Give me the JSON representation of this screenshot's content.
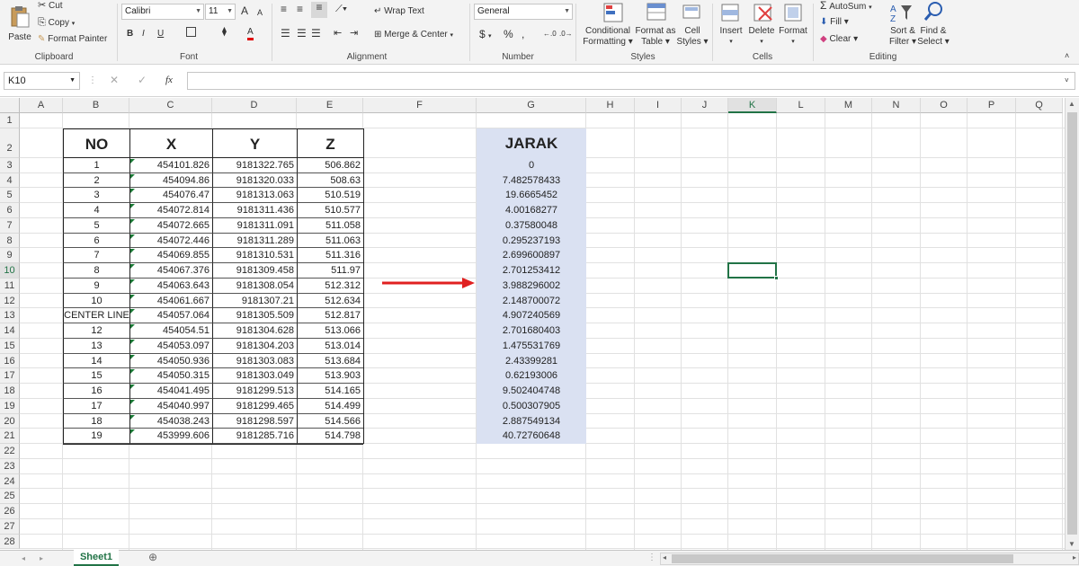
{
  "ribbon": {
    "clipboard": {
      "paste": "Paste",
      "cut": "Cut",
      "copy": "Copy",
      "format_painter": "Format Painter",
      "group": "Clipboard"
    },
    "font": {
      "name": "Calibri",
      "size": "11",
      "bold": "B",
      "italic": "I",
      "underline": "U",
      "grow": "A",
      "shrink": "A",
      "color_a": "A",
      "group": "Font"
    },
    "alignment": {
      "wrap": "Wrap Text",
      "merge": "Merge & Center",
      "group": "Alignment"
    },
    "number": {
      "format": "General",
      "currency": "$",
      "percent": "%",
      "comma": ",",
      "group": "Number"
    },
    "styles": {
      "conditional": "Conditional",
      "conditional2": "Formatting",
      "format_as": "Format as",
      "format_as2": "Table",
      "cell": "Cell",
      "cell2": "Styles",
      "group": "Styles"
    },
    "cells": {
      "insert": "Insert",
      "delete": "Delete",
      "format": "Format",
      "group": "Cells"
    },
    "editing": {
      "autosum": "AutoSum",
      "fill": "Fill",
      "clear": "Clear",
      "sort": "Sort &",
      "sort2": "Filter",
      "find": "Find &",
      "find2": "Select",
      "group": "Editing"
    }
  },
  "formula_bar": {
    "name_box": "K10",
    "fx": "fx",
    "value": ""
  },
  "columns": [
    "A",
    "B",
    "C",
    "D",
    "E",
    "F",
    "G",
    "H",
    "I",
    "J",
    "K",
    "L",
    "M",
    "N",
    "O",
    "P",
    "Q"
  ],
  "selected_column": "K",
  "selected_row": "10",
  "rows": [
    "1",
    "2",
    "3",
    "4",
    "5",
    "6",
    "7",
    "8",
    "9",
    "10",
    "11",
    "12",
    "13",
    "14",
    "15",
    "16",
    "17",
    "18",
    "19",
    "20",
    "21",
    "22",
    "23",
    "24",
    "25",
    "26",
    "27",
    "28"
  ],
  "table": {
    "headers": {
      "no": "NO",
      "x": "X",
      "y": "Y",
      "z": "Z"
    },
    "data": [
      {
        "no": "1",
        "x": "454101.826",
        "y": "9181322.765",
        "z": "506.862"
      },
      {
        "no": "2",
        "x": "454094.86",
        "y": "9181320.033",
        "z": "508.63"
      },
      {
        "no": "3",
        "x": "454076.47",
        "y": "9181313.063",
        "z": "510.519"
      },
      {
        "no": "4",
        "x": "454072.814",
        "y": "9181311.436",
        "z": "510.577"
      },
      {
        "no": "5",
        "x": "454072.665",
        "y": "9181311.091",
        "z": "511.058"
      },
      {
        "no": "6",
        "x": "454072.446",
        "y": "9181311.289",
        "z": "511.063"
      },
      {
        "no": "7",
        "x": "454069.855",
        "y": "9181310.531",
        "z": "511.316"
      },
      {
        "no": "8",
        "x": "454067.376",
        "y": "9181309.458",
        "z": "511.97"
      },
      {
        "no": "9",
        "x": "454063.643",
        "y": "9181308.054",
        "z": "512.312"
      },
      {
        "no": "10",
        "x": "454061.667",
        "y": "9181307.21",
        "z": "512.634"
      },
      {
        "no": "CENTER LINE",
        "x": "454057.064",
        "y": "9181305.509",
        "z": "512.817"
      },
      {
        "no": "12",
        "x": "454054.51",
        "y": "9181304.628",
        "z": "513.066"
      },
      {
        "no": "13",
        "x": "454053.097",
        "y": "9181304.203",
        "z": "513.014"
      },
      {
        "no": "14",
        "x": "454050.936",
        "y": "9181303.083",
        "z": "513.684"
      },
      {
        "no": "15",
        "x": "454050.315",
        "y": "9181303.049",
        "z": "513.903"
      },
      {
        "no": "16",
        "x": "454041.495",
        "y": "9181299.513",
        "z": "514.165"
      },
      {
        "no": "17",
        "x": "454040.997",
        "y": "9181299.465",
        "z": "514.499"
      },
      {
        "no": "18",
        "x": "454038.243",
        "y": "9181298.597",
        "z": "514.566"
      },
      {
        "no": "19",
        "x": "453999.606",
        "y": "9181285.716",
        "z": "514.798"
      }
    ]
  },
  "jarak": {
    "header": "JARAK",
    "values": [
      "0",
      "7.482578433",
      "19.6665452",
      "4.00168277",
      "0.37580048",
      "0.295237193",
      "2.699600897",
      "2.701253412",
      "3.988296002",
      "2.148700072",
      "4.907240569",
      "2.701680403",
      "1.475531769",
      "2.43399281",
      "0.62193006",
      "9.502404748",
      "0.500307905",
      "2.887549134",
      "40.72760648"
    ],
    "fill_color": "#dae1f2"
  },
  "arrow_color": "#e02020",
  "sheet_tab": "Sheet1",
  "accent": "#217346"
}
